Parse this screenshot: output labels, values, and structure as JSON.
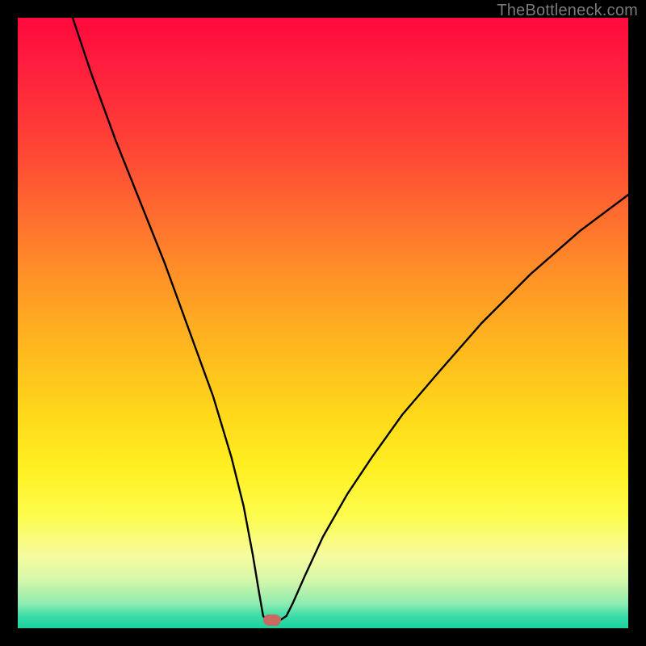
{
  "watermark": "TheBottleneck.com",
  "chart_data": {
    "type": "line",
    "title": "",
    "xlabel": "",
    "ylabel": "",
    "xlim": [
      0,
      100
    ],
    "ylim": [
      0,
      100
    ],
    "grid": false,
    "legend": false,
    "series": [
      {
        "name": "curve",
        "x": [
          9,
          12,
          16,
          20,
          24,
          28,
          32,
          35,
          37,
          38.5,
          39.5,
          40.2,
          41.0,
          42.5,
          44.0,
          45.0,
          47.0,
          50,
          54,
          58,
          63,
          69,
          76,
          84,
          92,
          100
        ],
        "values": [
          100,
          91,
          80,
          70,
          60,
          49,
          38,
          28,
          20,
          12,
          6,
          2.0,
          1.0,
          1.0,
          2.0,
          4.0,
          8.5,
          15,
          22,
          28,
          35,
          42,
          50,
          58,
          65,
          71
        ]
      }
    ],
    "marker": {
      "x": 41.7,
      "y": 1.3
    },
    "colors": {
      "curve_stroke": "#000000",
      "marker_fill": "#c96a62",
      "gradient_top": "#ff0a3c",
      "gradient_bottom": "#18d39e"
    }
  }
}
